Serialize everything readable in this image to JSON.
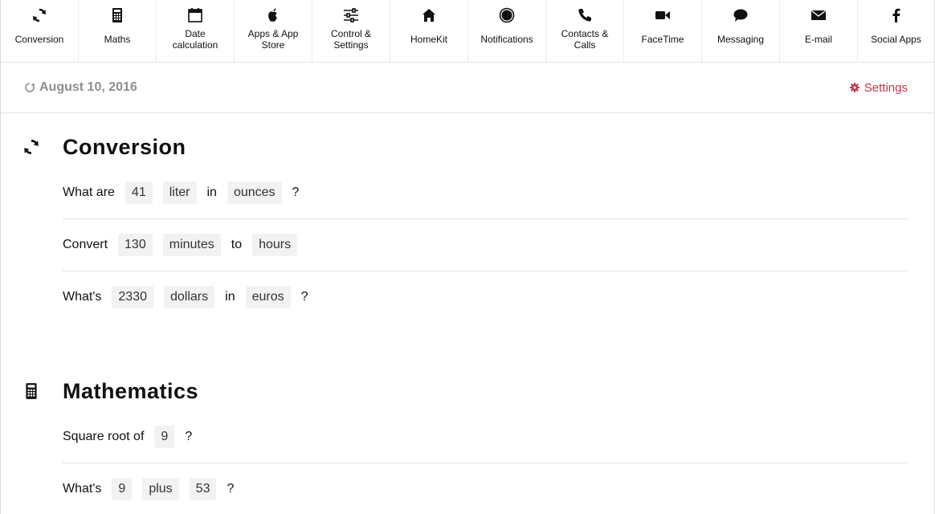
{
  "nav": [
    {
      "icon": "refresh-icon",
      "label": "Conversion"
    },
    {
      "icon": "calculator-icon",
      "label": "Maths"
    },
    {
      "icon": "calendar-icon",
      "label": "Date calculation"
    },
    {
      "icon": "apple-icon",
      "label": "Apps & App Store"
    },
    {
      "icon": "sliders-icon",
      "label": "Control & Settings"
    },
    {
      "icon": "home-icon",
      "label": "HomeKit"
    },
    {
      "icon": "record-circle-icon",
      "label": "Notifications"
    },
    {
      "icon": "phone-icon",
      "label": "Contacts & Calls"
    },
    {
      "icon": "video-camera-icon",
      "label": "FaceTime"
    },
    {
      "icon": "speech-bubble-icon",
      "label": "Messaging"
    },
    {
      "icon": "envelope-icon",
      "label": "E-mail"
    },
    {
      "icon": "facebook-icon",
      "label": "Social Apps"
    }
  ],
  "datebar": {
    "date": "August 10, 2016",
    "settings_label": "Settings",
    "accent_color": "#c8304a"
  },
  "sections": {
    "conversion": {
      "title": "Conversion",
      "icon": "refresh-icon",
      "rows": [
        {
          "parts": [
            "What are",
            "41",
            "liter",
            "in",
            "ounces",
            "?"
          ]
        },
        {
          "parts": [
            "Convert",
            "130",
            "minutes",
            "to",
            "hours"
          ]
        },
        {
          "parts": [
            "What's",
            "2330",
            "dollars",
            "in",
            "euros",
            "?"
          ]
        }
      ]
    },
    "mathematics": {
      "title": "Mathematics",
      "icon": "calculator-icon",
      "rows": [
        {
          "parts": [
            "Square root of",
            "9",
            "?"
          ]
        },
        {
          "parts": [
            "What's",
            "9",
            "plus",
            "53",
            "?"
          ]
        }
      ]
    }
  }
}
